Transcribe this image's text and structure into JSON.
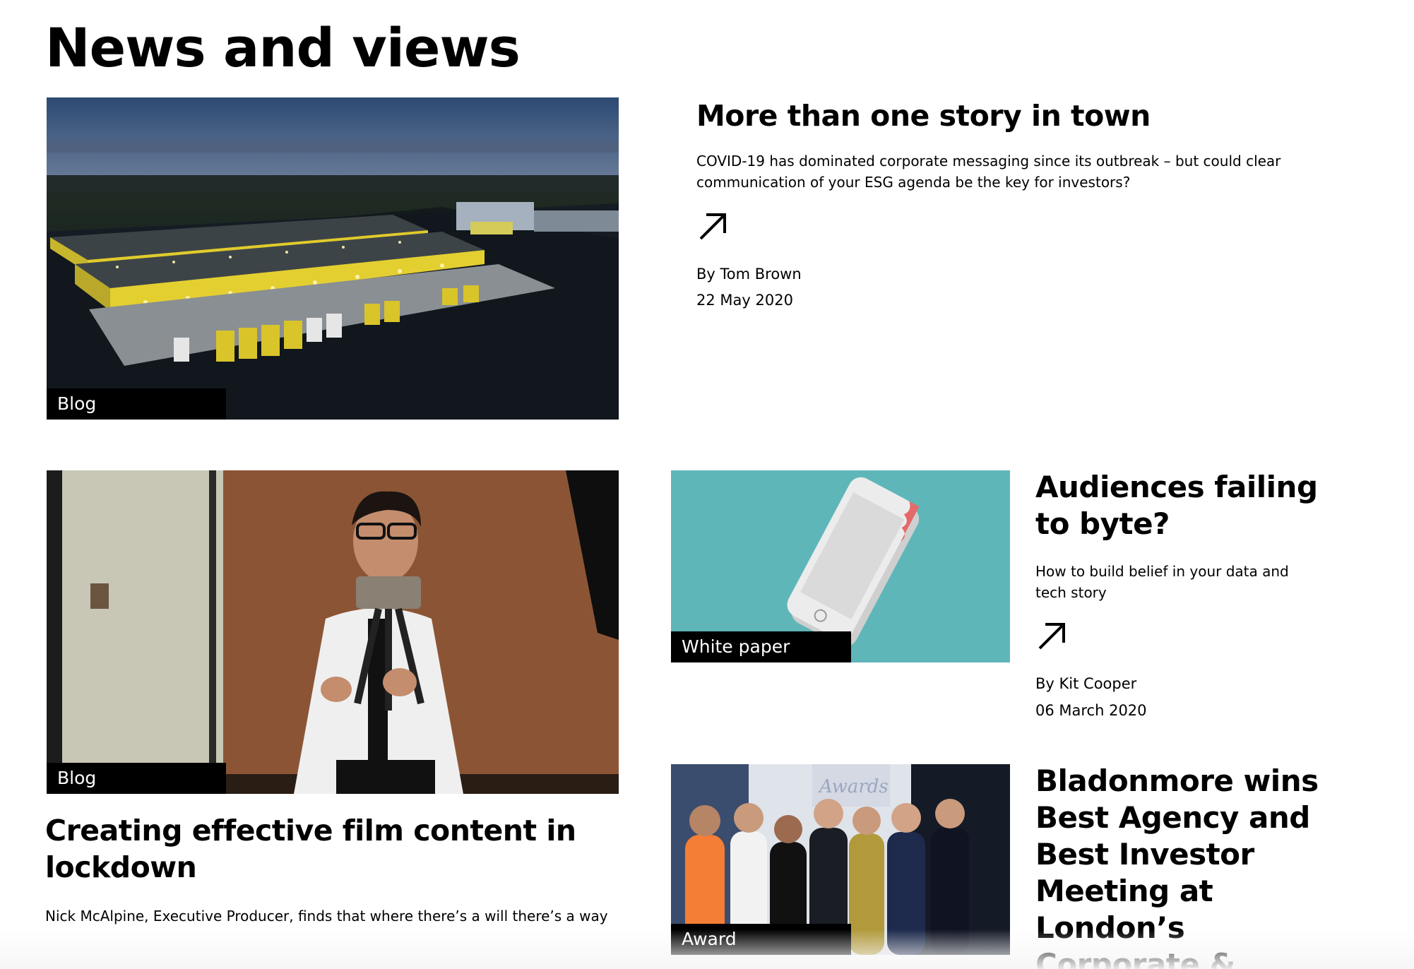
{
  "section": {
    "title": "News and views"
  },
  "articles": [
    {
      "tag": "Blog",
      "title": "More than one story in town",
      "excerpt": "COVID-19 has dominated corporate messaging since its outbreak – but could clear communication of your ESG agenda be the key for investors?",
      "author": "By Tom Brown",
      "date": "22 May 2020",
      "image_icon": "warehouse-photo"
    },
    {
      "tag": "Blog",
      "title": "Creating effective film content in lockdown",
      "excerpt": "Nick McAlpine, Executive Producer, finds that where there’s a will there’s a way",
      "image_icon": "presenter-filming-photo"
    },
    {
      "tag": "White paper",
      "title": "Audiences failing to byte?",
      "excerpt": "How to build belief in your data and tech story",
      "author": "By Kit Cooper",
      "date": "06 March 2020",
      "image_icon": "bitten-phone-illustration"
    },
    {
      "tag": "Award",
      "title": "Bladonmore wins Best Agency and Best Investor Meeting at London’s Corporate &",
      "image_icon": "award-team-photo"
    }
  ],
  "icons": {
    "read_more": "arrow-up-right-icon"
  },
  "colors": {
    "tag_background": "#000000",
    "tag_text": "#ffffff",
    "illustration_teal": "#5fb6b9"
  }
}
